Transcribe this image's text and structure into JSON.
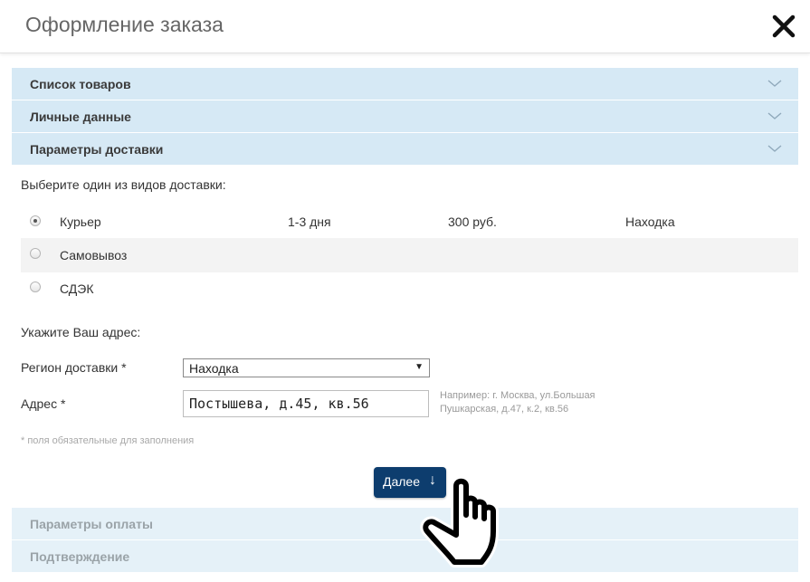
{
  "window": {
    "title": "Оформление заказа",
    "close_icon": "close-icon"
  },
  "accordion": {
    "sections": [
      {
        "label": "Список товаров",
        "expanded": false
      },
      {
        "label": "Личные данные",
        "expanded": false
      },
      {
        "label": "Параметры доставки",
        "expanded": true
      },
      {
        "label": "Параметры оплаты",
        "expanded": false
      },
      {
        "label": "Подтверждение",
        "expanded": false
      }
    ]
  },
  "delivery": {
    "prompt": "Выберите один из видов доставки:",
    "options": [
      {
        "name": "Курьер",
        "duration": "1-3 дня",
        "price": "300 руб.",
        "city": "Находка",
        "selected": true
      },
      {
        "name": "Самовывоз",
        "selected": false
      },
      {
        "name": "СДЭК",
        "selected": false
      }
    ]
  },
  "address": {
    "prompt": "Укажите Ваш адрес:",
    "region_label": "Регион доставки *",
    "region_value": "Находка",
    "address_label": "Адрес *",
    "address_value": "Постышева, д.45, кв.56",
    "hint_line1": "Например: г. Москва, ул.Большая",
    "hint_line2": "Пушкарская, д.47, к.2, кв.56",
    "required_note": "* поля обязательные для заполнения"
  },
  "next_button": {
    "label": "Далее",
    "arrow": "↓"
  },
  "colors": {
    "section_header": "#d6e9f5",
    "section_header_inactive": "#e5f1f8",
    "primary_button": "#0d3d6e"
  }
}
